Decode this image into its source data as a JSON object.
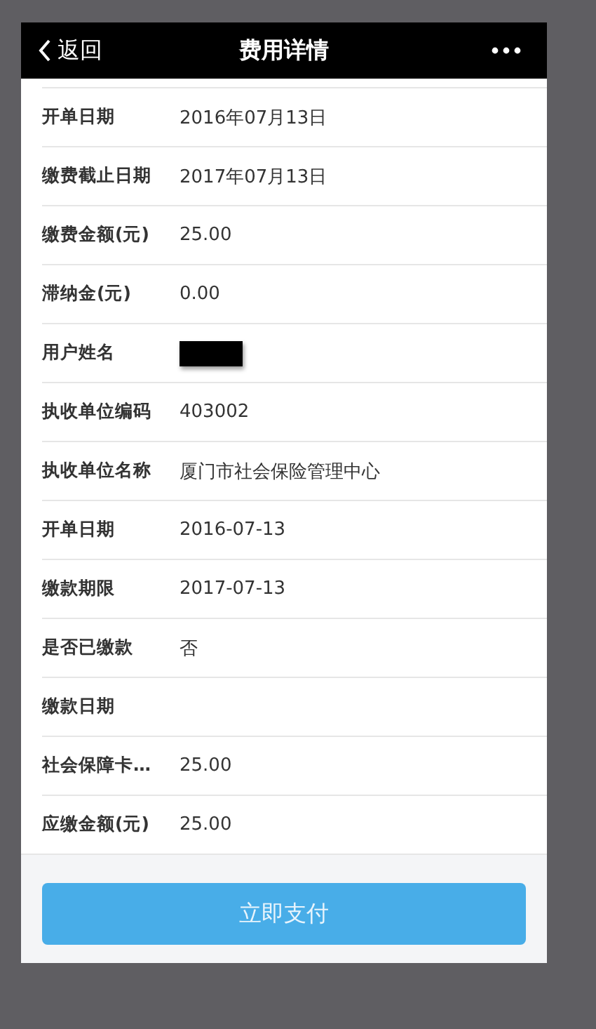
{
  "header": {
    "back": "返回",
    "title": "费用详情"
  },
  "rows": [
    {
      "label": "开单日期",
      "value": "2016年07月13日"
    },
    {
      "label": "缴费截止日期",
      "value": "2017年07月13日"
    },
    {
      "label": "缴费金额(元)",
      "value": "25.00"
    },
    {
      "label": "滞纳金(元)",
      "value": "0.00"
    },
    {
      "label": "用户姓名",
      "redacted": true
    },
    {
      "label": "执收单位编码",
      "value": "403002"
    },
    {
      "label": "执收单位名称",
      "value": "厦门市社会保险管理中心"
    },
    {
      "label": "开单日期",
      "value": "2016-07-13"
    },
    {
      "label": "缴款期限",
      "value": "2017-07-13"
    },
    {
      "label": "是否已缴款",
      "value": "否"
    },
    {
      "label": "缴款日期"
    },
    {
      "label": "社会保障卡…",
      "value": "25.00"
    },
    {
      "label": "应缴金额(元)",
      "value": "25.00"
    }
  ],
  "pay_button": "立即支付"
}
